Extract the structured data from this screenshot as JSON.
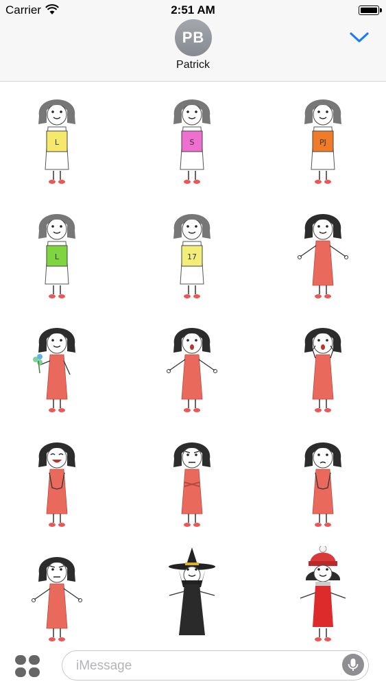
{
  "status_bar": {
    "carrier": "Carrier",
    "time": "2:51 AM"
  },
  "header": {
    "avatar_initials": "PB",
    "contact_name": "Patrick"
  },
  "compose": {
    "placeholder": "iMessage"
  },
  "colors": {
    "accent": "#1a7cf5",
    "dress": "#e96a5c",
    "hair": "#2c2c2c"
  },
  "stickers": [
    {
      "variant": "sign",
      "hair": "gray",
      "sign_color": "#f5e86a",
      "sign_text": "L"
    },
    {
      "variant": "sign",
      "hair": "gray",
      "sign_color": "#ee6fd0",
      "sign_text": "S"
    },
    {
      "variant": "sign",
      "hair": "gray",
      "sign_color": "#f07c2a",
      "sign_text": "PJ"
    },
    {
      "variant": "sign",
      "hair": "gray",
      "sign_color": "#7fd53f",
      "sign_text": "L"
    },
    {
      "variant": "sign",
      "hair": "gray",
      "sign_color": "#f3ee7a",
      "sign_text": "17"
    },
    {
      "variant": "arms-out",
      "hair": "black",
      "face": "smile"
    },
    {
      "variant": "flower",
      "hair": "black",
      "face": "smile"
    },
    {
      "variant": "arms-out",
      "hair": "black",
      "face": "surprised"
    },
    {
      "variant": "cheeks",
      "hair": "black",
      "face": "surprised"
    },
    {
      "variant": "hands-front",
      "hair": "black",
      "face": "laugh"
    },
    {
      "variant": "arms-crossed",
      "hair": "black",
      "face": "annoyed"
    },
    {
      "variant": "hands-front",
      "hair": "black",
      "face": "worried"
    },
    {
      "variant": "arms-out",
      "hair": "black",
      "face": "grumpy"
    },
    {
      "variant": "witch",
      "hair": "black",
      "face": "smile"
    },
    {
      "variant": "winter",
      "hair": "black",
      "face": "smile"
    }
  ]
}
